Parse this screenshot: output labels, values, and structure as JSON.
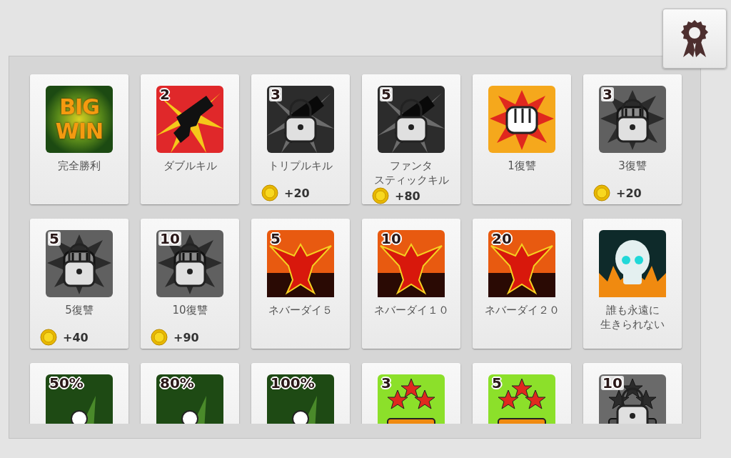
{
  "achievements": [
    {
      "title": "完全勝利",
      "kind": "bigwin",
      "caption": "BIG WIN",
      "locked": false
    },
    {
      "title": "ダブルキル",
      "kind": "gun",
      "badge": "2",
      "locked": false
    },
    {
      "title": "トリプルキル",
      "kind": "gun",
      "badge": "3",
      "locked": true,
      "reward": "+20"
    },
    {
      "title_lines": [
        "ファンタ",
        "スティックキル"
      ],
      "kind": "gun",
      "badge": "5",
      "locked": true,
      "reward": "+80"
    },
    {
      "title": "1復讐",
      "kind": "fist",
      "locked": false
    },
    {
      "title": "3復讐",
      "kind": "fist",
      "badge": "3",
      "locked": true,
      "reward": "+20"
    },
    {
      "title": "5復讐",
      "kind": "fist",
      "badge": "5",
      "locked": true,
      "reward": "+40"
    },
    {
      "title": "10復讐",
      "kind": "fist",
      "badge": "10",
      "locked": true,
      "reward": "+90"
    },
    {
      "title": "ネバーダイ５",
      "kind": "phoenix",
      "badge": "5",
      "locked": false
    },
    {
      "title": "ネバーダイ１０",
      "kind": "phoenix",
      "badge": "10",
      "locked": false
    },
    {
      "title": "ネバーダイ２０",
      "kind": "phoenix",
      "badge": "20",
      "locked": false
    },
    {
      "title_lines": [
        "誰も永遠に",
        "生きられない"
      ],
      "kind": "skull",
      "locked": false
    },
    {
      "kind": "spotlight",
      "badge": "50%",
      "locked": false
    },
    {
      "kind": "spotlight",
      "badge": "80%",
      "locked": false
    },
    {
      "kind": "spotlight",
      "badge": "100%",
      "locked": false
    },
    {
      "kind": "mvp",
      "badge": "3",
      "locked": false
    },
    {
      "kind": "mvp",
      "badge": "5",
      "locked": false
    },
    {
      "kind": "mvp",
      "badge": "10",
      "locked": true
    }
  ]
}
